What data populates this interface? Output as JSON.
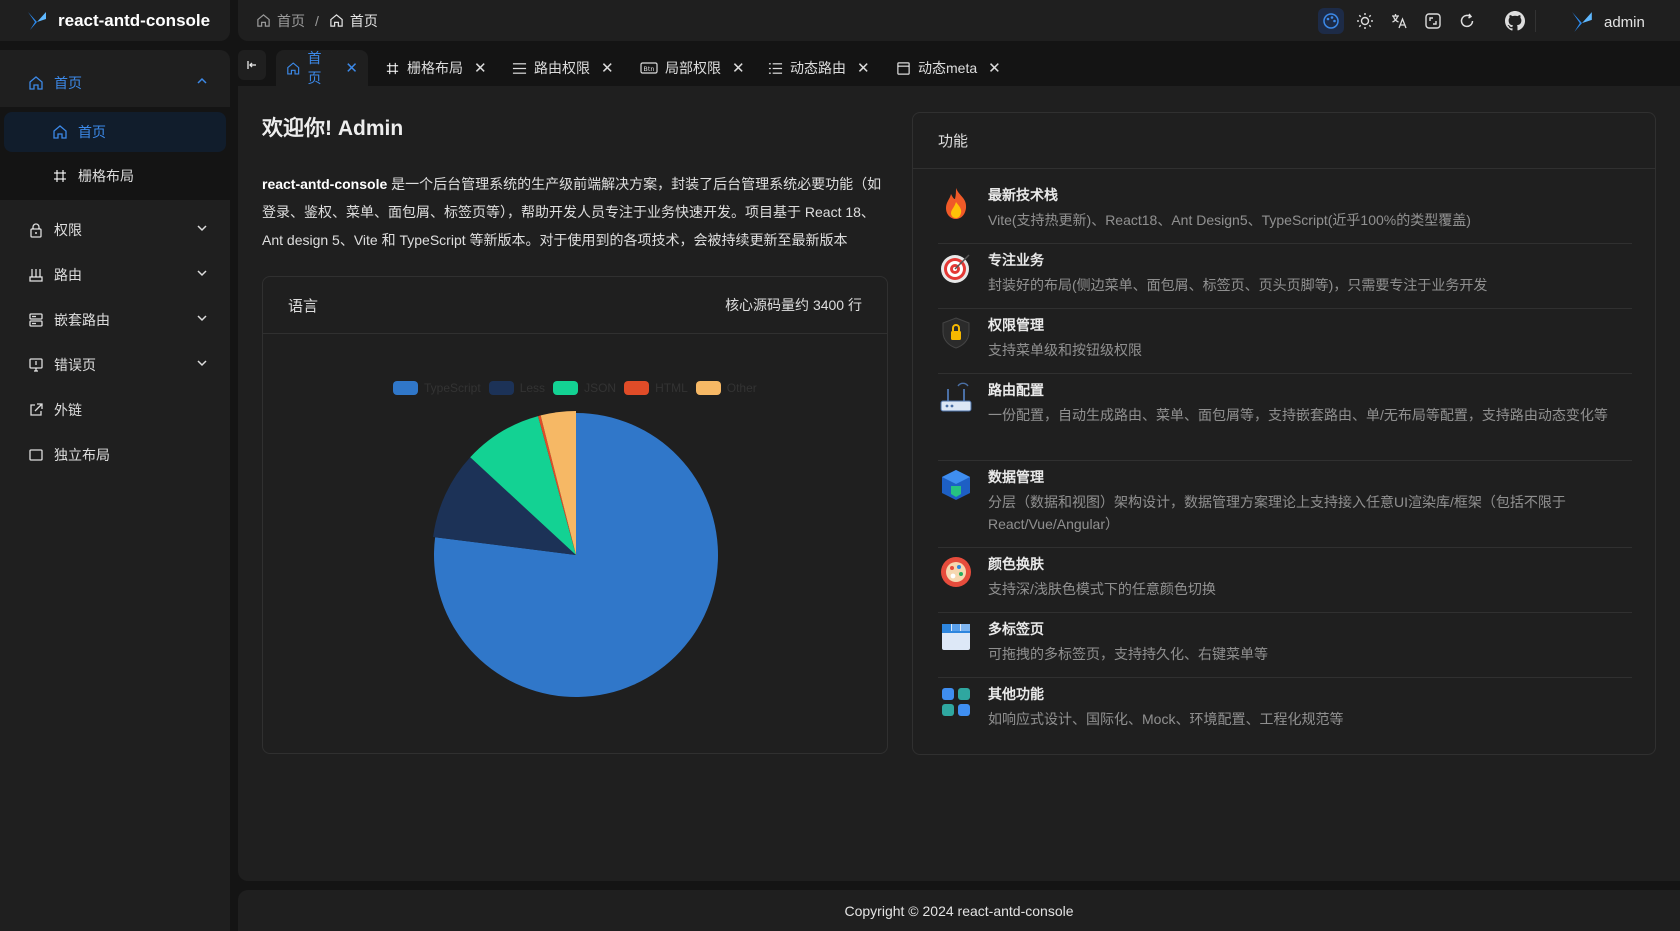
{
  "app": {
    "title": "react-antd-console"
  },
  "header": {
    "breadcrumb": {
      "root": "首页",
      "separator": "/",
      "current": "首页"
    },
    "icons": [
      "theme-color-icon",
      "sun-icon",
      "translate-icon",
      "fullscreen-icon",
      "refresh-icon",
      "github-icon"
    ],
    "user": "admin"
  },
  "sidebar": {
    "items": [
      {
        "label": "首页",
        "icon": "home-icon",
        "expanded": true
      },
      {
        "label": "首页",
        "icon": "home-icon",
        "selected": true
      },
      {
        "label": "栅格布局",
        "icon": "grid-icon"
      },
      {
        "label": "权限",
        "icon": "lock-icon"
      },
      {
        "label": "路由",
        "icon": "route-icon"
      },
      {
        "label": "嵌套路由",
        "icon": "nested-icon"
      },
      {
        "label": "错误页",
        "icon": "error-page-icon"
      },
      {
        "label": "外链",
        "icon": "external-link-icon"
      },
      {
        "label": "独立布局",
        "icon": "layout-icon"
      }
    ]
  },
  "tabs": [
    {
      "label": "首页",
      "icon": "home-icon",
      "active": true
    },
    {
      "label": "栅格布局",
      "icon": "grid-icon"
    },
    {
      "label": "路由权限",
      "icon": "menu-icon"
    },
    {
      "label": "局部权限",
      "icon": "btn-icon"
    },
    {
      "label": "动态路由",
      "icon": "list-icon"
    },
    {
      "label": "动态meta",
      "icon": "window-icon"
    }
  ],
  "main": {
    "welcome": "欢迎你! Admin",
    "intro": {
      "brand": "react-antd-console",
      "line1": " 是一个后台管理系统的生产级前端解决方案，封装了后台管理系统必要功能（如",
      "line2": "登录、鉴权、菜单、面包屑、标签页等），帮助开发人员专注于业务快速开发。项目基于 React 18、",
      "line3": "Ant design 5、Vite 和 TypeScript 等新版本。对于使用到的各项技术，会被持续更新至最新版本"
    },
    "language_card": {
      "title": "语言",
      "summary": "核心源码量约 3400 行"
    },
    "features_card": {
      "title": "功能",
      "items": [
        {
          "title": "最新技术栈",
          "desc": "Vite(支持热更新)、React18、Ant Design5、TypeScript(近乎100%的类型覆盖)",
          "icon": "fire-icon"
        },
        {
          "title": "专注业务",
          "desc": "封装好的布局(侧边菜单、面包屑、标签页、页头页脚等)，只需要专注于业务开发",
          "icon": "target-icon"
        },
        {
          "title": "权限管理",
          "desc": "支持菜单级和按钮级权限",
          "icon": "shield-lock-icon"
        },
        {
          "title": "路由配置",
          "desc": "一份配置，自动生成路由、菜单、面包屑等，支持嵌套路由、单/无布局等配置，支持路由动态变化等",
          "icon": "router-icon"
        },
        {
          "title": "数据管理",
          "desc": "分层（数据和视图）架构设计，数据管理方案理论上支持接入任意UI渲染库/框架（包括不限于React/Vue/Angular）",
          "icon": "data-cube-icon"
        },
        {
          "title": "颜色换肤",
          "desc": "支持深/浅肤色模式下的任意颜色切换",
          "icon": "palette-icon"
        },
        {
          "title": "多标签页",
          "desc": "可拖拽的多标签页，支持持久化、右键菜单等",
          "icon": "tabs-window-icon"
        },
        {
          "title": "其他功能",
          "desc": "如响应式设计、国际化、Mock、环境配置、工程化规范等",
          "icon": "apps-icon"
        }
      ]
    }
  },
  "footer": {
    "text": "Copyright © 2024 react-antd-console"
  },
  "chart_data": {
    "type": "pie",
    "categories": [
      "TypeScript",
      "Less",
      "JSON",
      "HTML",
      "Other"
    ],
    "values": [
      78,
      10,
      9,
      0.3,
      4
    ],
    "colors": [
      "#3077c9",
      "#1c3257",
      "#13d293",
      "#e04c28",
      "#f6b865"
    ],
    "legend_position": "top",
    "start_angle_deg": 0
  },
  "colors": {
    "accent": "#3c89e8",
    "bg": "#141414",
    "panel": "#1f1f1f"
  }
}
